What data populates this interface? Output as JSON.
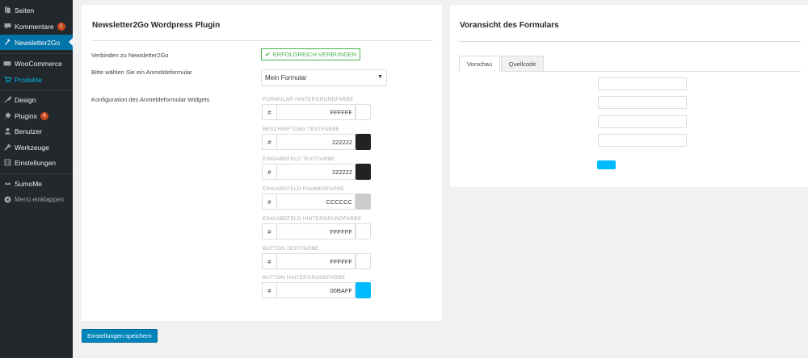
{
  "sidebar": {
    "items": [
      {
        "label": "Seiten",
        "icon": "pages-icon"
      },
      {
        "label": "Kommentare",
        "icon": "comments-icon",
        "badge": "1"
      },
      {
        "label": "Newsletter2Go",
        "icon": "newsletter-icon"
      },
      {
        "label": "WooCommerce",
        "icon": "woocommerce-icon"
      },
      {
        "label": "Produkte",
        "icon": "products-icon"
      },
      {
        "label": "Design",
        "icon": "design-icon"
      },
      {
        "label": "Plugins",
        "icon": "plugins-icon",
        "badge": "4"
      },
      {
        "label": "Benutzer",
        "icon": "user-icon"
      },
      {
        "label": "Werkzeuge",
        "icon": "tools-icon"
      },
      {
        "label": "Einstellungen",
        "icon": "settings-icon"
      },
      {
        "label": "SumoMe",
        "icon": "sumome-icon"
      },
      {
        "label": "Menü einklappen",
        "icon": "collapse-icon"
      }
    ]
  },
  "plugin": {
    "title": "Newsletter2Go Wordpress Plugin",
    "connect_label": "Verbinden zu Newsletter2Go",
    "status": "ERFOLGREICH VERBUNDEN",
    "form_select_label": "Bitte wählen Sie ein Anmeldeformular",
    "form_select_value": "Mein Formular",
    "config_label": "Konfiguration des Anmeldeformular Widgets",
    "hash": "#",
    "fields": [
      {
        "label": "FORMULAR HINTERGRUNDFARBE",
        "value": "FFFFFF",
        "color": "#ffffff"
      },
      {
        "label": "BESCHRIFTUNG TEXTFARBE",
        "value": "222222",
        "color": "#222222"
      },
      {
        "label": "EINGABEFELD TEXTFARBE",
        "value": "222222",
        "color": "#222222"
      },
      {
        "label": "EINGABEFELD RAHMENFARBE",
        "value": "CCCCCC",
        "color": "#cccccc"
      },
      {
        "label": "EINGABEFELD HINTERGRUNDFARBE",
        "value": "FFFFFF",
        "color": "#ffffff"
      },
      {
        "label": "BUTTON TEXTFARBE",
        "value": "FFFFFF",
        "color": "#ffffff"
      },
      {
        "label": "BUTTON HINTERGRUNDFARBE",
        "value": "00BAFF",
        "color": "#00baff"
      }
    ],
    "save_label": "Einstellungen speichern"
  },
  "preview": {
    "title": "Voransicht des Formulars",
    "tabs": [
      "Vorschau",
      "Quellcode"
    ],
    "button_color": "#00baff"
  }
}
